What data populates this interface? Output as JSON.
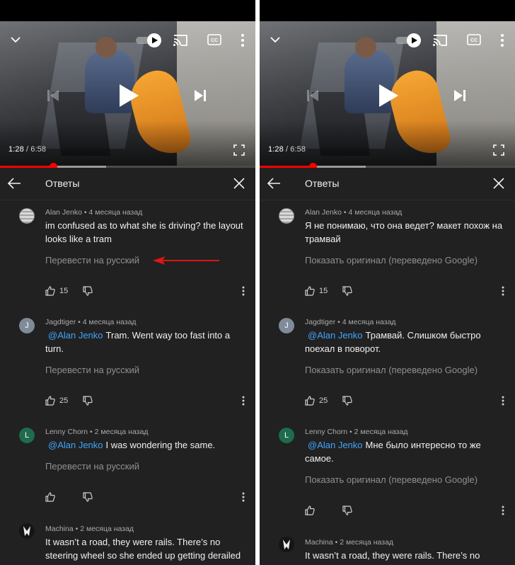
{
  "player": {
    "time_current": "1:28",
    "time_separator": " / ",
    "time_duration": "6:58",
    "progress_played_fraction": 0.2105,
    "icons": [
      "chevron-down-icon",
      "autoplay-toggle-icon",
      "cast-icon",
      "captions-icon",
      "more-vert-icon",
      "previous-icon",
      "play-icon",
      "next-icon",
      "fullscreen-icon"
    ]
  },
  "replies_header": {
    "title": "Ответы"
  },
  "panels": [
    {
      "comments": [
        {
          "author": "Alan Jenko",
          "age": "4 месяца назад",
          "mention": "",
          "text": "im confused as to what she is driving? the layout looks like a tram",
          "action": "Перевести на русский",
          "likes": "15"
        },
        {
          "author": "Jagdtiger",
          "age": "4 месяца назад",
          "mention": "@Alan Jenko",
          "text": "Tram. Went way too fast into a turn.",
          "action": "Перевести на русский",
          "likes": "25"
        },
        {
          "author": "Lenny Chorn",
          "age": "2 месяца назад",
          "mention": "@Alan Jenko",
          "text": "I was wondering the same.",
          "action": "Перевести на русский",
          "likes": ""
        },
        {
          "author": "Machina",
          "age": "2 месяца назад",
          "mention": "",
          "text": "It wasn’t a road,  they were rails. There’s no steering wheel so she ended up getting derailed",
          "action": "",
          "likes": ""
        }
      ]
    },
    {
      "comments": [
        {
          "author": "Alan Jenko",
          "age": "4 месяца назад",
          "mention": "",
          "text": "Я не понимаю, что она ведет? макет похож на трамвай",
          "action": "Показать оригинал (переведено Google)",
          "likes": "15"
        },
        {
          "author": "Jagdtiger",
          "age": "4 месяца назад",
          "mention": "@Alan Jenko",
          "text": "Трамвай. Слишком быстро поехал в поворот.",
          "action": "Показать оригинал (переведено Google)",
          "likes": "25"
        },
        {
          "author": "Lenny Chorn",
          "age": "2 месяца назад",
          "mention": "@Alan Jenko",
          "text": "Мне было интересно то же самое.",
          "action": "Показать оригинал (переведено Google)",
          "likes": ""
        },
        {
          "author": "Machina",
          "age": "2 месяца назад",
          "mention": "",
          "text": "It wasn’t a road,  they were rails. There’s no",
          "action": "",
          "likes": ""
        }
      ]
    }
  ],
  "avatars": {
    "jagdtiger_letter": "J",
    "lenny_letter": "L"
  },
  "annotation": {
    "arrow_color": "#e01616",
    "points_to": "translate-link"
  },
  "colors": {
    "background": "#212121",
    "mention": "#3ea6ff",
    "progress": "#ff0000"
  }
}
